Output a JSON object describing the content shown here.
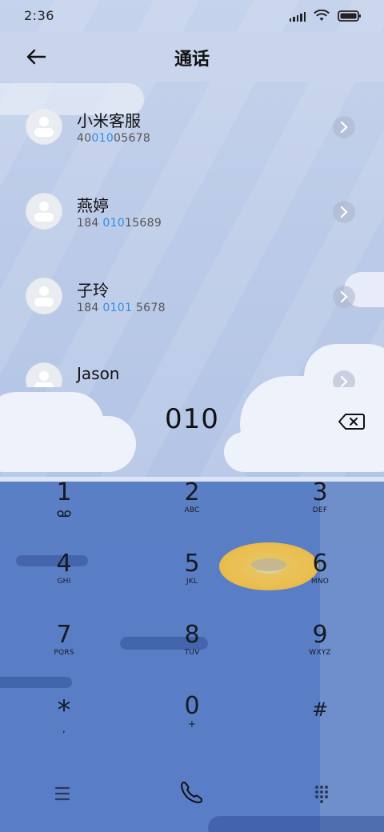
{
  "status_bar": {
    "time": "2:36"
  },
  "header": {
    "title": "通话"
  },
  "contacts": [
    {
      "name": "小米客服",
      "number_parts": [
        "40",
        "010",
        "05678"
      ]
    },
    {
      "name": "燕婷",
      "number_parts": [
        "184 ",
        "010",
        "15689"
      ]
    },
    {
      "name": "子玲",
      "number_parts": [
        "184 ",
        "0101",
        " 5678"
      ]
    },
    {
      "name": "Jason",
      "number_parts": [
        "",
        "",
        ""
      ]
    }
  ],
  "dialer": {
    "number": "010",
    "keys": [
      {
        "digit": "1",
        "letters": ""
      },
      {
        "digit": "2",
        "letters": "ABC"
      },
      {
        "digit": "3",
        "letters": "DEF"
      },
      {
        "digit": "4",
        "letters": "GHI"
      },
      {
        "digit": "5",
        "letters": "JKL"
      },
      {
        "digit": "6",
        "letters": "MNO"
      },
      {
        "digit": "7",
        "letters": "PQRS"
      },
      {
        "digit": "8",
        "letters": "TUV"
      },
      {
        "digit": "9",
        "letters": "WXYZ"
      },
      {
        "digit": "*",
        "letters": ","
      },
      {
        "digit": "0",
        "letters": "+"
      },
      {
        "digit": "#",
        "letters": ""
      }
    ]
  },
  "icons": {
    "back": "back-arrow-icon",
    "delete": "backspace-icon",
    "voicemail": "voicemail-icon",
    "menu": "menu-icon",
    "call": "phone-icon",
    "keypad_toggle": "dialpad-icon"
  },
  "colors": {
    "highlight": "#2f8ee8",
    "text": "#111111"
  }
}
